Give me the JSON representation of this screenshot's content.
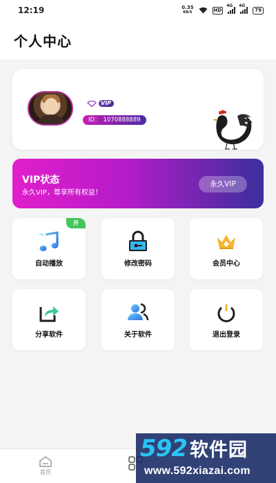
{
  "status_bar": {
    "time": "12:19",
    "net_speed_value": "0.35",
    "net_speed_unit": "KB/S",
    "hd": "HD",
    "signal1": "4G",
    "signal2": "4G",
    "battery": "79"
  },
  "header": {
    "title": "个人中心"
  },
  "profile": {
    "vip_tag": "VIP",
    "id_label": "ID：",
    "id_value": "1070888889"
  },
  "vip_banner": {
    "title": "VIP状态",
    "subtitle": "永久VIP，尊享所有权益！",
    "button": "永久VIP"
  },
  "tiles": [
    {
      "label": "自动播放",
      "icon": "music-note-icon",
      "badge": "开"
    },
    {
      "label": "修改密码",
      "icon": "lock-icon"
    },
    {
      "label": "会员中心",
      "icon": "crown-icon"
    },
    {
      "label": "分享软件",
      "icon": "share-icon"
    },
    {
      "label": "关于软件",
      "icon": "users-icon"
    },
    {
      "label": "退出登录",
      "icon": "power-icon"
    }
  ],
  "bottom_nav": {
    "home_label": "首页"
  },
  "watermark": {
    "num": "592",
    "cn": "软件园",
    "url": "www.592xiazai.com"
  },
  "colors": {
    "accent_magenta": "#e21ecb",
    "accent_indigo": "#3a2f9d",
    "badge_green": "#44c55a",
    "watermark_blue": "#2ac4f4"
  }
}
